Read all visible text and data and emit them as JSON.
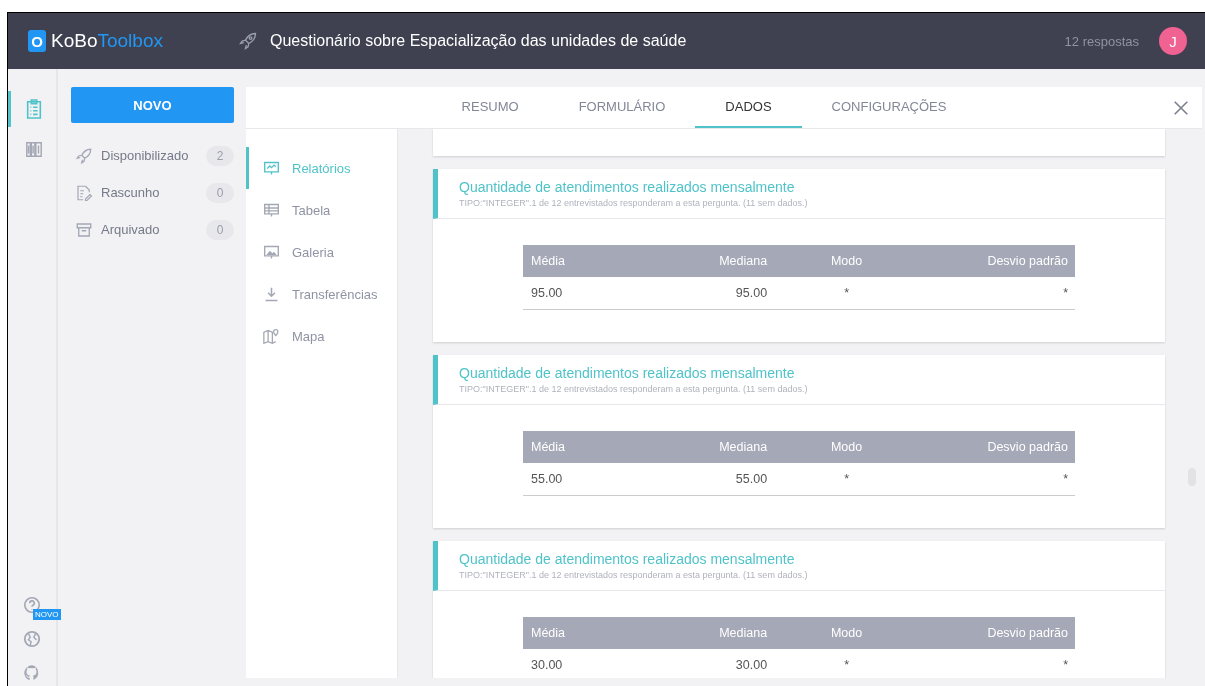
{
  "header": {
    "logo_box": "O",
    "logo_a": "KoBo",
    "logo_b": "Toolbox",
    "title": "Questionário sobre Espacialização das unidades de saúde",
    "responses": "12 respostas",
    "avatar": "J"
  },
  "rail": [
    {
      "kind": "forms",
      "selected": true
    },
    {
      "kind": "library",
      "selected": false
    }
  ],
  "rail_bottom": {
    "badge": "NOVO"
  },
  "sidebar": {
    "new_button": "NOVO",
    "items": [
      {
        "kind": "deployed",
        "label": "Disponibilizado",
        "count": "2"
      },
      {
        "kind": "draft",
        "label": "Rascunho",
        "count": "0"
      },
      {
        "kind": "archived",
        "label": "Arquivado",
        "count": "0"
      }
    ]
  },
  "tabs": [
    {
      "label": "RESUMO",
      "selected": false
    },
    {
      "label": "FORMULÁRIO",
      "selected": false
    },
    {
      "label": "DADOS",
      "selected": true
    },
    {
      "label": "CONFIGURAÇÕES",
      "selected": false
    }
  ],
  "subnav": [
    {
      "kind": "reports",
      "label": "Relatórios",
      "selected": true
    },
    {
      "kind": "table",
      "label": "Tabela",
      "selected": false
    },
    {
      "kind": "gallery",
      "label": "Galeria",
      "selected": false
    },
    {
      "kind": "downloads",
      "label": "Transferências",
      "selected": false
    },
    {
      "kind": "map",
      "label": "Mapa",
      "selected": false
    }
  ],
  "reports": [
    {
      "title": "Quantidade de atendimentos realizados mensalmente",
      "subtitle": "TIPO:\"INTEGER\".1 de 12 entrevistados responderam a esta pergunta. (11 sem dados.)",
      "columns": [
        "Média",
        "Mediana",
        "Modo",
        "Desvio padrão"
      ],
      "row": [
        "95.00",
        "95.00",
        "*",
        "*"
      ]
    },
    {
      "title": "Quantidade de atendimentos realizados mensalmente",
      "subtitle": "TIPO:\"INTEGER\".1 de 12 entrevistados responderam a esta pergunta. (11 sem dados.)",
      "columns": [
        "Média",
        "Mediana",
        "Modo",
        "Desvio padrão"
      ],
      "row": [
        "55.00",
        "55.00",
        "*",
        "*"
      ]
    },
    {
      "title": "Quantidade de atendimentos realizados mensalmente",
      "subtitle": "TIPO:\"INTEGER\".1 de 12 entrevistados responderam a esta pergunta. (11 sem dados.)",
      "columns": [
        "Média",
        "Mediana",
        "Modo",
        "Desvio padrão"
      ],
      "row": [
        "30.00",
        "30.00",
        "*",
        "*"
      ]
    }
  ]
}
